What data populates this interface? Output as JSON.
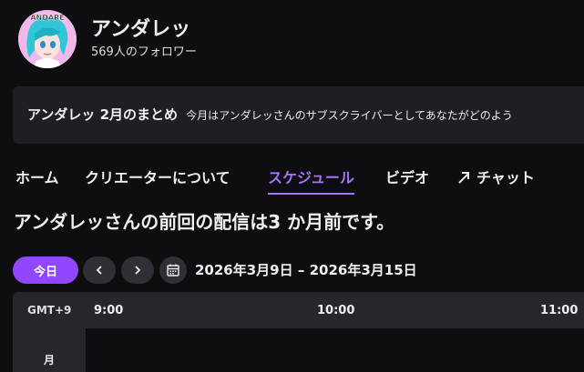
{
  "channel": {
    "name": "アンダレッ",
    "followers": "569人のフォロワー",
    "avatar_text": "ANDARE"
  },
  "banner": {
    "title": "アンダレッ 2月のまとめ",
    "description": "今月はアンダレッさんのサブスクライバーとしてあなたがどのよう"
  },
  "tabs": [
    {
      "label": "ホーム"
    },
    {
      "label": "クリエーターについて"
    },
    {
      "label": "スケジュール",
      "active": true
    },
    {
      "label": "ビデオ"
    },
    {
      "label": "チャット"
    }
  ],
  "headline": "アンダレッさんの前回の配信は3 か月前です。",
  "controls": {
    "today_label": "今日",
    "date_range": "2026年3月9日 – 2026年3月15日"
  },
  "schedule": {
    "timezone": "GMT+9",
    "times": [
      "9:00",
      "10:00",
      "11:00"
    ],
    "day": "月"
  },
  "colors": {
    "accent": "#a970ff",
    "button": "#9147ff",
    "background": "#0e0e10",
    "surface": "#1f1f23"
  }
}
